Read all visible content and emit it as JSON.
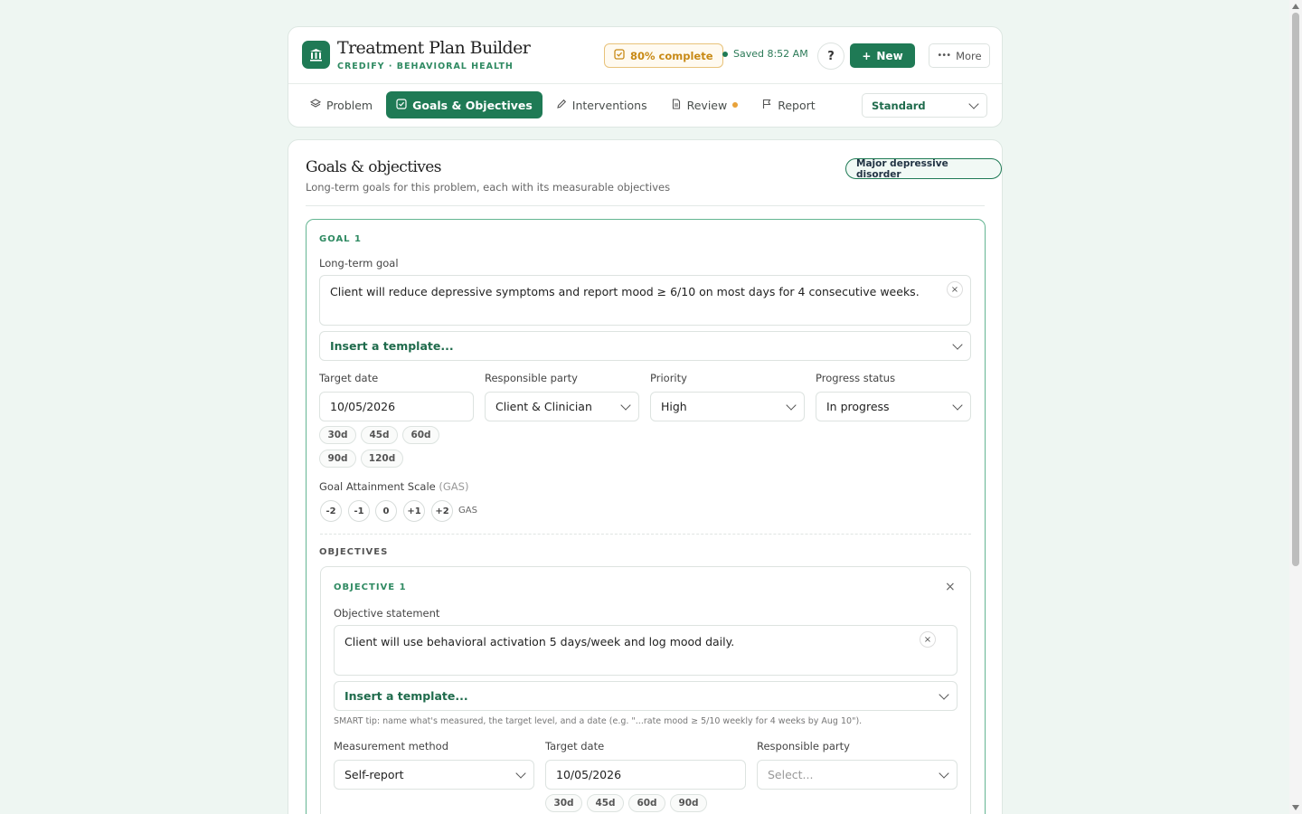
{
  "header": {
    "title": "Treatment Plan Builder",
    "subtitle": "CREDIFY · BEHAVIORAL HEALTH",
    "progress_label": "80% complete",
    "saved_label": "Saved 8:52 AM",
    "help_label": "?",
    "new_label": "New",
    "more_label": "More",
    "mode_selected": "Standard"
  },
  "tabs": [
    {
      "label": "Problem",
      "icon": "layers-icon"
    },
    {
      "label": "Goals & Objectives",
      "icon": "check-square-icon",
      "active": true
    },
    {
      "label": "Interventions",
      "icon": "pencil-icon"
    },
    {
      "label": "Review",
      "icon": "document-icon",
      "dot": true
    },
    {
      "label": "Report",
      "icon": "flag-icon"
    }
  ],
  "section": {
    "title": "Goals & objectives",
    "subtitle": "Long-term goals for this problem, each with its measurable objectives",
    "diagnosis": "Major depressive disorder"
  },
  "goal": {
    "heading": "GOAL 1",
    "long_term_label": "Long-term goal",
    "long_term_value": "Client will reduce depressive symptoms and report mood ≥ 6/10 on most days for 4 consecutive weeks.",
    "template_placeholder": "Insert a template...",
    "target_date_label": "Target date",
    "target_date_value": "10/05/2026",
    "responsible_label": "Responsible party",
    "responsible_value": "Client & Clinician",
    "priority_label": "Priority",
    "priority_value": "High",
    "progress_label": "Progress status",
    "progress_value": "In progress",
    "date_chips": [
      "30d",
      "45d",
      "60d",
      "90d",
      "120d"
    ],
    "gas_label": "Goal Attainment Scale",
    "gas_label_suffix": "(GAS)",
    "gas_options": [
      "-2",
      "-1",
      "0",
      "+1",
      "+2"
    ],
    "gas_tag": "GAS"
  },
  "objectives": {
    "heading": "OBJECTIVES",
    "items": [
      {
        "heading": "OBJECTIVE 1",
        "statement_label": "Objective statement",
        "statement_value": "Client will use behavioral activation 5 days/week and log mood daily.",
        "template_placeholder": "Insert a template...",
        "smart_tip": "SMART tip: name what's measured, the target level, and a date (e.g. \"...rate mood ≥ 5/10 weekly for 4 weeks by Aug 10\").",
        "measurement_label": "Measurement method",
        "measurement_value": "Self-report",
        "target_date_label": "Target date",
        "target_date_value": "10/05/2026",
        "responsible_label": "Responsible party",
        "responsible_placeholder": "Select...",
        "date_chips": [
          "30d",
          "45d",
          "60d",
          "90d"
        ]
      }
    ]
  },
  "colors": {
    "brand": "#1f7a55",
    "warning": "#c88a16"
  }
}
